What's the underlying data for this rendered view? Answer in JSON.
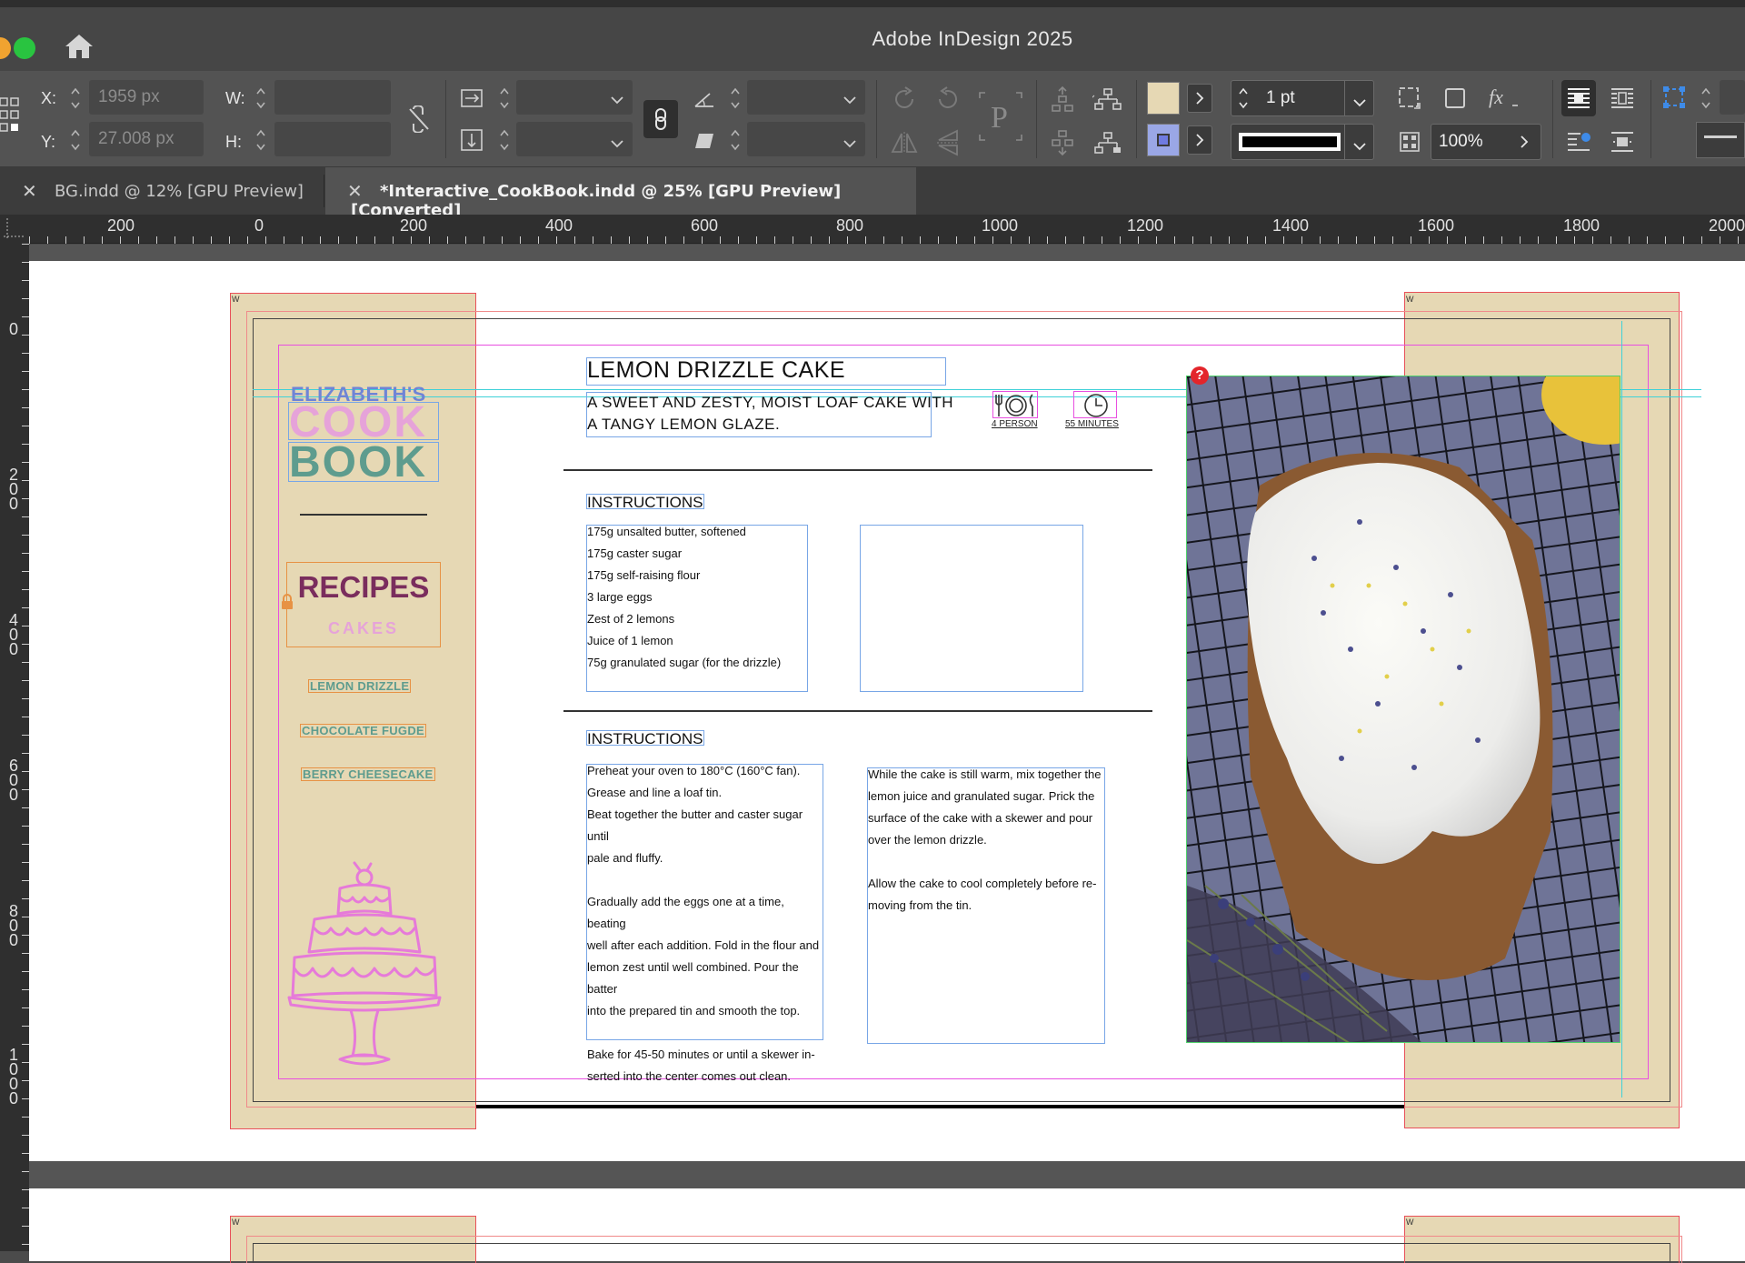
{
  "app": {
    "title": "Adobe InDesign 2025",
    "colors": {
      "accent_blue": "#3e8be8",
      "paper": "#e6d8b4",
      "lavender": "#9aa7e6"
    }
  },
  "control": {
    "x_label": "X:",
    "x_value": "1959 px",
    "y_label": "Y:",
    "y_value": "27.008 px",
    "w_label": "W:",
    "h_label": "H:",
    "stroke_weight": "1 pt",
    "opacity": "100%"
  },
  "tabs": [
    {
      "label": "BG.indd @ 12% [GPU Preview]",
      "close": "✕"
    },
    {
      "label": "*Interactive_CookBook.indd @ 25% [GPU Preview] [Converted]",
      "close": "✕"
    }
  ],
  "ruler": {
    "h": [
      "200",
      "0",
      "200",
      "400",
      "600",
      "800",
      "1000",
      "1200",
      "1400",
      "1600",
      "1800",
      "2000"
    ],
    "v": [
      "0",
      "2\n0\n0",
      "4\n0\n0",
      "6\n0\n0",
      "8\n0\n0",
      "1\n0\n0\n0"
    ]
  },
  "document": {
    "brand": {
      "line1": "ELIZABETH'S",
      "line2": "COOK",
      "line3": "BOOK"
    },
    "recipes_heading": "RECIPES",
    "category": "CAKES",
    "nav": [
      "LEMON DRIZZLE",
      "CHOCOLATE FUGDE",
      "BERRY CHEESECAKE"
    ],
    "recipe_title": "LEMON DRIZZLE CAKE",
    "subtitle_line1": "A SWEET AND ZESTY, MOIST LOAF CAKE WITH",
    "subtitle_line2": "A TANGY LEMON GLAZE.",
    "serves": "4 PERSON",
    "time": "55 MINUTES",
    "section1_heading": "INSTRUCTIONS",
    "ingredients": [
      "175g unsalted butter, softened",
      "175g caster sugar",
      "175g self-raising flour",
      "3 large eggs",
      "Zest of 2 lemons",
      "Juice of 1 lemon",
      "75g granulated sugar (for the drizzle)"
    ],
    "section2_heading": "INSTRUCTIONS",
    "steps_left": [
      "Preheat your oven to 180°C (160°C fan).",
      "Grease and line a loaf tin.",
      "Beat together the butter and caster sugar until",
      "pale and fluffy.",
      "",
      "Gradually add the eggs one at a time, beating",
      "well after each addition. Fold in the flour and",
      "lemon zest until well combined. Pour the batter",
      "into the prepared tin and smooth the top.",
      "",
      "Bake for 45-50 minutes or until a skewer in-",
      "serted into the center comes out clean."
    ],
    "steps_right": [
      "While the cake is still warm, mix together the",
      "lemon juice and granulated sugar. Prick the",
      "surface of the cake with a skewer and pour",
      "over the lemon drizzle.",
      "",
      "Allow the cake to cool completely before re-",
      "moving from the tin."
    ],
    "page_marker": "W"
  }
}
